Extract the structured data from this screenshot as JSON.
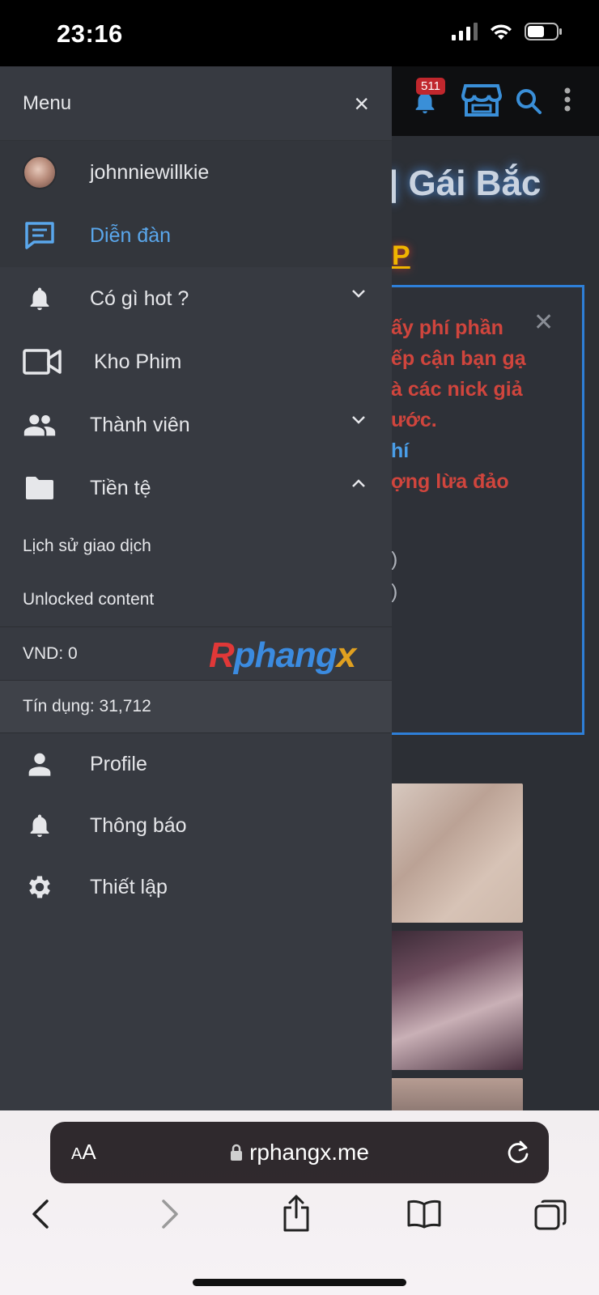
{
  "status": {
    "time": "23:16"
  },
  "background": {
    "notification_count": "511",
    "title": "| Gái Bắc",
    "title_letter": "P",
    "notice_lines": [
      "ấy phí phần",
      "ếp cận bạn gạ",
      "à các nick giả",
      "ước.",
      "hí",
      "ợng lừa đảo",
      ")",
      ")"
    ]
  },
  "drawer": {
    "title": "Menu",
    "close": "×",
    "username": "johnniewillkie",
    "items": [
      {
        "label": "Diễn đàn",
        "icon": "forum-icon"
      },
      {
        "label": "Có gì hot ?",
        "icon": "bell-icon"
      },
      {
        "label": "Kho Phim",
        "icon": "video-camera-icon"
      },
      {
        "label": "Thành viên",
        "icon": "people-icon"
      },
      {
        "label": "Tiền tệ",
        "icon": "folder-icon"
      }
    ],
    "submenu": [
      "Lịch sử giao dịch",
      "Unlocked content"
    ],
    "vnd": "VND: 0",
    "credit": "Tín dụng: 31,712",
    "logo": {
      "r": "R",
      "p": "phang",
      "x": "x"
    },
    "account_items": [
      {
        "label": "Profile",
        "icon": "person-icon"
      },
      {
        "label": "Thông báo",
        "icon": "bell-icon"
      },
      {
        "label": "Thiết lập",
        "icon": "gear-icon"
      }
    ]
  },
  "safari": {
    "aa_small": "A",
    "aa_large": "A",
    "url": "rphangx.me"
  },
  "colors": {
    "accent": "#5aa7ec",
    "drawer_bg": "#373a41",
    "alert_red": "#d0453d"
  }
}
